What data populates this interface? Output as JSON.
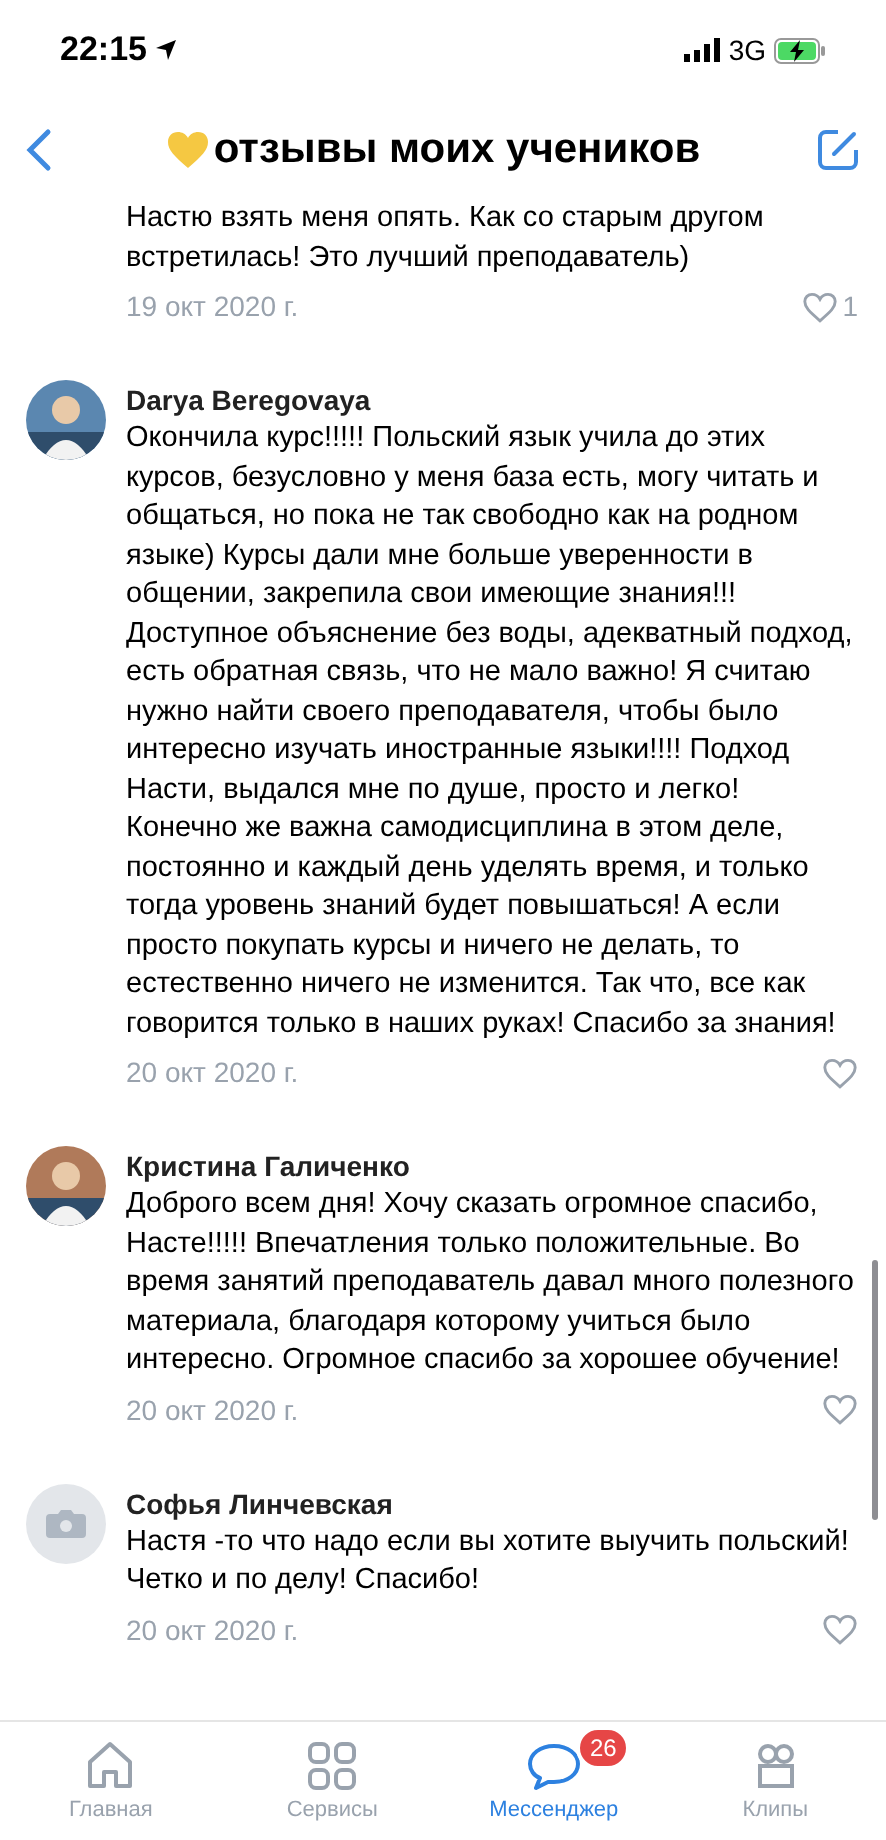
{
  "status_bar": {
    "time": "22:15",
    "network": "3G"
  },
  "header": {
    "title": "отзывы моих учеников"
  },
  "comments": [
    {
      "text": "Настю взять меня опять. Как со старым другом встретилась! Это лучший преподаватель)",
      "date": "19 окт 2020 г.",
      "likes": "1"
    },
    {
      "author": "Darya Beregovaya",
      "text": "Окончила курс!!!!! Польский язык учила до этих курсов, безусловно у меня база есть, могу читать и общаться, но пока не так свободно как на родном языке) Курсы дали мне больше уверенности в общении, закрепила свои имеющие знания!!! Доступное объяснение без воды, адекватный подход, есть обратная связь, что не мало важно! Я считаю нужно найти своего преподавателя, чтобы было интересно изучать иностранные языки!!!! Подход Насти, выдался мне по душе, просто и легко! Конечно же важна самодисциплина в этом деле, постоянно и каждый день уделять время, и только тогда уровень знаний будет повышаться! А если просто покупать курсы и ничего не делать, то естественно ничего не изменится. Так что, все как говорится только в наших руках! Спасибо за знания!",
      "date": "20 окт 2020 г."
    },
    {
      "author": "Кристина Галиченко",
      "text": "Доброго всем дня! Хочу сказать огромное спасибо, Насте!!!!! Впечатления только положительные. Во время занятий преподаватель давал много полезного материала, благодаря которому учиться было интересно. Огромное спасибо за хорошее обучение!",
      "date": "20 окт 2020 г."
    },
    {
      "author": "Софья Линчевская",
      "avatar": {
        "kind": "placeholder"
      },
      "text": "Настя -то что надо если вы хотите выучить польский! Четко и по делу! Спасибо!",
      "date": "20 окт 2020 г."
    }
  ],
  "tab_bar": [
    {
      "kind": "home",
      "label": "Главная",
      "selected": false
    },
    {
      "kind": "services",
      "label": "Сервисы",
      "selected": false
    },
    {
      "kind": "messenger",
      "label": "Мессенджер",
      "selected": true,
      "badge": "26"
    },
    {
      "kind": "clips",
      "label": "Клипы",
      "selected": false
    }
  ]
}
